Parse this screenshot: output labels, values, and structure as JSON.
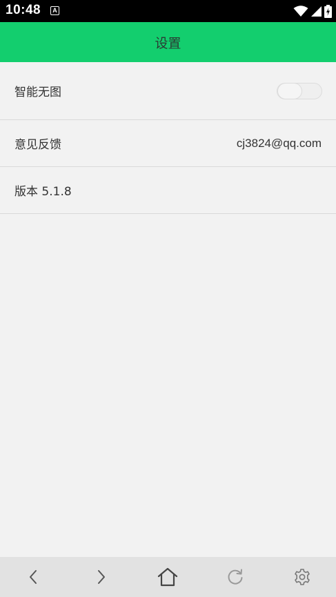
{
  "status_bar": {
    "time": "10:48",
    "notification_icon_letter": "A",
    "icons": [
      "wifi-icon",
      "signal-icon",
      "battery-charging-icon"
    ]
  },
  "app_bar": {
    "title": "设置"
  },
  "settings": {
    "smart_no_image": {
      "label": "智能无图",
      "enabled": false
    },
    "feedback": {
      "label": "意见反馈",
      "value": "cj3824@qq.com"
    },
    "version": {
      "label": "版本 5.1.8"
    }
  },
  "bottom_nav": {
    "icons": [
      "back-icon",
      "forward-icon",
      "home-icon",
      "refresh-icon",
      "settings-icon"
    ]
  },
  "colors": {
    "accent": "#13ce6e",
    "background": "#f2f2f2",
    "bottom_bar": "#e2e2e2"
  }
}
